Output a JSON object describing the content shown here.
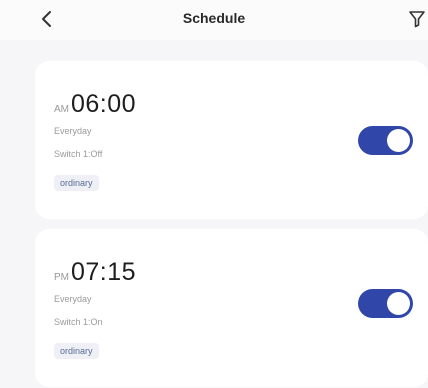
{
  "header": {
    "title": "Schedule",
    "back_icon": "chevron-left-icon",
    "filter_icon": "filter-icon"
  },
  "accent_color": "#3046a8",
  "schedules": [
    {
      "ampm": "AM",
      "time": "06:00",
      "repeat": "Everyday",
      "action": "Switch 1:Off",
      "tag": "ordinary",
      "enabled": true
    },
    {
      "ampm": "PM",
      "time": "07:15",
      "repeat": "Everyday",
      "action": "Switch 1:On",
      "tag": "ordinary",
      "enabled": true
    }
  ]
}
